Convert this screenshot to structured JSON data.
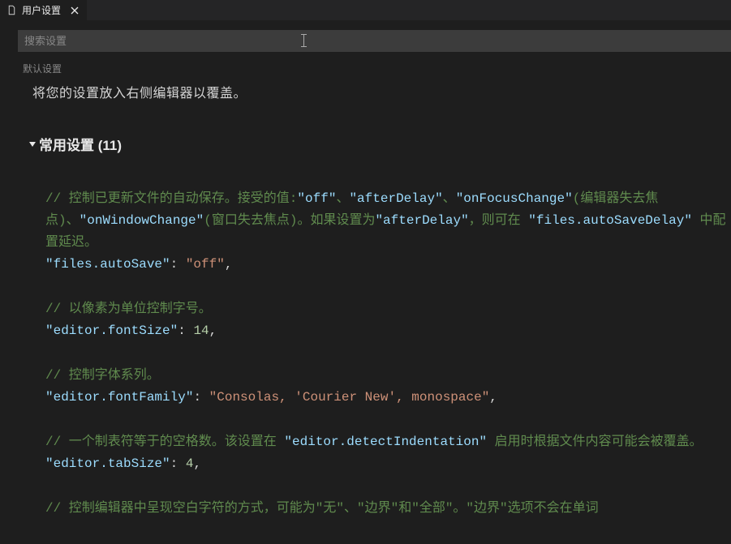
{
  "tab": {
    "title": "用户设置"
  },
  "search": {
    "placeholder": "搜索设置"
  },
  "defaultLabel": "默认设置",
  "instruction": "将您的设置放入右侧编辑器以覆盖。",
  "section": {
    "title": "常用设置 (11)"
  },
  "settings": {
    "autoSave": {
      "comment_p1": "//  控制已更新文件的自动保存。接受的值:",
      "comment_v1": "\"off\"",
      "comment_s1": "、",
      "comment_v2": "\"afterDelay\"",
      "comment_s2": "、",
      "comment_v3": "\"onFocusChange\"",
      "comment_p2": "(编辑器失去焦点)、",
      "comment_v4": "\"onWindowChange\"",
      "comment_p3": "(窗口失去焦点)。如果设置为",
      "comment_v5": "\"afterDelay\"",
      "comment_p4": "，则可在 ",
      "comment_v6": "\"files.autoSaveDelay\"",
      "comment_p5": " 中配置延迟。",
      "key": "\"files.autoSave\"",
      "value": "\"off\""
    },
    "fontSize": {
      "comment": "//  以像素为单位控制字号。",
      "key": "\"editor.fontSize\"",
      "value": "14"
    },
    "fontFamily": {
      "comment": "//  控制字体系列。",
      "key": "\"editor.fontFamily\"",
      "value": "\"Consolas, 'Courier New', monospace\""
    },
    "tabSize": {
      "comment_p1": "//  一个制表符等于的空格数。该设置在 ",
      "comment_v1": "\"editor.detectIndentation\"",
      "comment_p2": " 启用时根据文件内容可能会被覆盖。",
      "key": "\"editor.tabSize\"",
      "value": "4"
    },
    "whitespace": {
      "comment": "//  控制编辑器中呈现空白字符的方式，可能为\"无\"、\"边界\"和\"全部\"。\"边界\"选项不会在单词"
    }
  }
}
